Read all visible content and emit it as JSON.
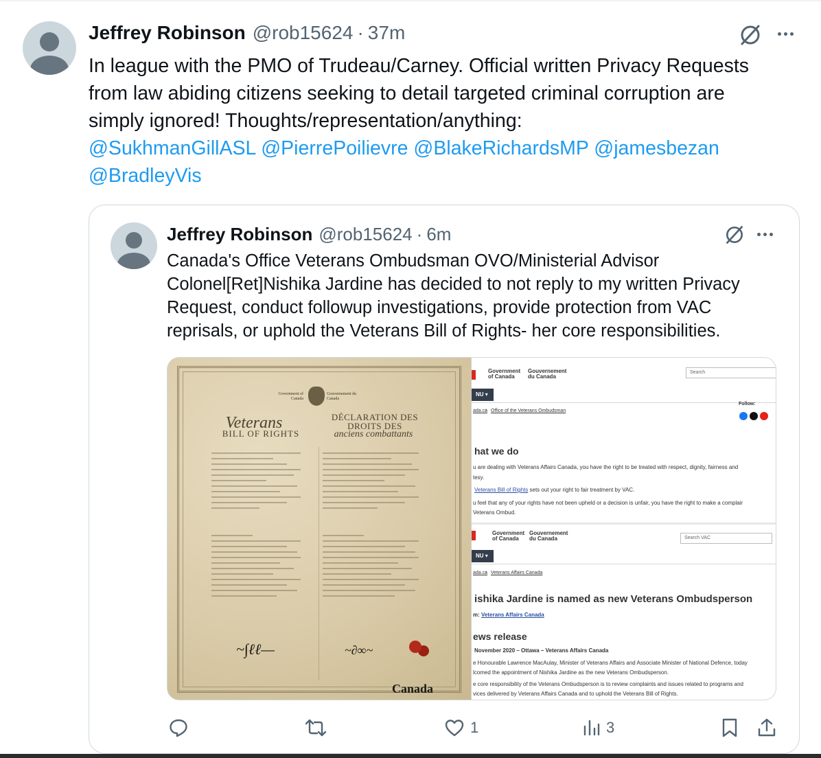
{
  "tweet": {
    "author_name": "Jeffrey Robinson",
    "author_handle": "@rob15624",
    "separator": "·",
    "time": "37m",
    "text_plain": "In league with the PMO of Trudeau/Carney. Official written Privacy Requests from law abiding citizens seeking to detail targeted criminal corruption are simply ignored! Thoughts/representation/anything:",
    "mentions": [
      "@SukhmanGillASL",
      "@PierrePoilievre",
      "@BlakeRichardsMP",
      "@jamesbezan",
      "@BradleyVis"
    ]
  },
  "quoted_tweet": {
    "author_name": "Jeffrey Robinson",
    "author_handle": "@rob15624",
    "separator": "·",
    "time": "6m",
    "text": "Canada's Office Veterans Ombudsman OVO/Ministerial Advisor Colonel[Ret]Nishika Jardine has decided to not reply to my written Privacy Request, conduct followup investigations, provide protection from VAC reprisals, or uphold the Veterans Bill of Rights- her core responsibilities."
  },
  "media": {
    "left_doc": {
      "gov_en": "Government of Canada",
      "gov_fr": "Gouvernement du Canada",
      "title_en_1": "Veterans",
      "title_en_2": "BILL OF RIGHTS",
      "title_fr_1": "DÉCLARATION DES DROITS DES",
      "title_fr_2": "anciens combattants",
      "wordmark": "Canada"
    },
    "web1": {
      "gov_en": "Government of Canada",
      "gov_fr": "Gouvernement du Canada",
      "search": "Search",
      "menu": "NU",
      "crumb_1": "ada.ca",
      "crumb_2": "Office of the Veterans Ombudsman",
      "follow": "Follow:",
      "heading": "hat we do",
      "p1": "u are dealing with Veterans Affairs Canada, you have the right to be treated with respect, dignity, fairness and",
      "p1b": "tesy.",
      "p2_link": "Veterans Bill of Rights",
      "p2": " sets out your right to fair treatment by VAC.",
      "p3": "u feel that any of your rights have not been upheld or a decision is unfair, you have the right to make a complair",
      "p3b": "Veterans Ombud."
    },
    "web2": {
      "gov_en": "Government of Canada",
      "gov_fr": "Gouvernement du Canada",
      "search": "Search VAC",
      "menu": "NU",
      "crumb_1": "ada.ca",
      "crumb_2": "Veterans Affairs Canada",
      "heading": "ishika Jardine is named as new Veterans Ombudsperson",
      "from_label": "m: ",
      "from_link": "Veterans Affairs Canada",
      "subheading": "ews release",
      "dateline": "November 2020 – Ottawa – Veterans Affairs Canada",
      "p1": "e Honourable Lawrence MacAulay, Minister of Veterans Affairs and Associate Minister of National Defence, today",
      "p1b": "lcomed the appointment of Nishika Jardine as the new Veterans Ombudsperson.",
      "p2": "e core responsibility of the Veterans Ombudsperson is to review complaints and issues related to programs and",
      "p2b": "vices delivered by Veterans Affairs Canada and to uphold the Veterans Bill of Rights."
    }
  },
  "actions": {
    "reply_count": "",
    "retweet_count": "",
    "like_count": "1",
    "views_count": "3"
  },
  "icons": {
    "grok": "slashed-circle-icon",
    "more": "more-dots-icon",
    "reply": "reply-icon",
    "retweet": "retweet-icon",
    "like": "heart-icon",
    "views": "views-bar-icon",
    "bookmark": "bookmark-icon",
    "share": "share-icon"
  },
  "colors": {
    "mention": "#1d9bf0",
    "secondary_text": "#536471",
    "border": "#cfd9de"
  }
}
